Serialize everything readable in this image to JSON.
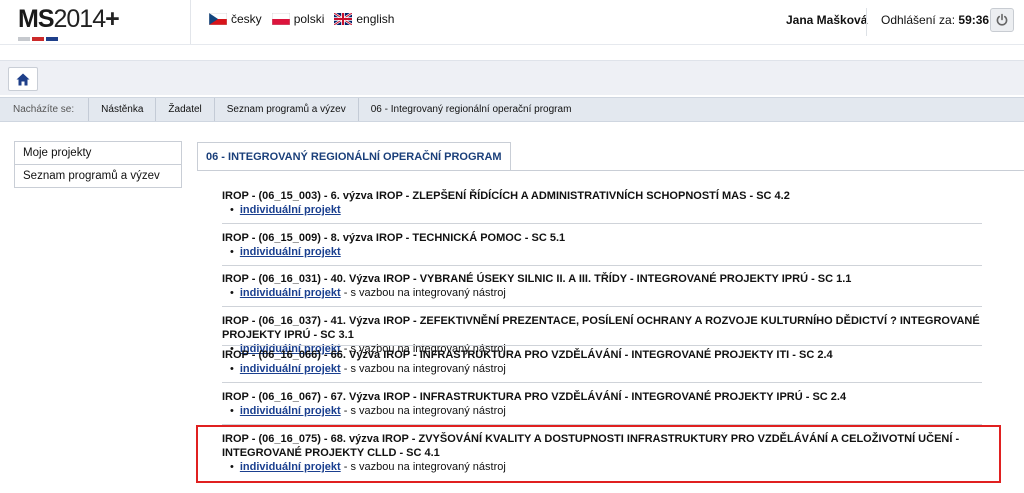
{
  "header": {
    "logo_ms": "MS",
    "logo_year": "2014",
    "logo_plus": "+",
    "languages": [
      {
        "label": "česky",
        "flag": "cz-flag-icon"
      },
      {
        "label": "polski",
        "flag": "pl-flag-icon"
      },
      {
        "label": "english",
        "flag": "uk-flag-icon"
      }
    ],
    "user_name": "Jana Mašková",
    "logout_label": "Odhlášení za:",
    "logout_timer": "59:36",
    "power_icon": "power-icon"
  },
  "toolbar": {
    "home_icon": "home-icon"
  },
  "breadcrumb": {
    "label": "Nacházíte se:",
    "items": [
      "Nástěnka",
      "Žadatel",
      "Seznam programů a výzev",
      "06 - Integrovaný regionální operační program"
    ]
  },
  "leftmenu": {
    "items": [
      "Moje projekty",
      "Seznam programů a výzev"
    ]
  },
  "tab": {
    "label": "06 - INTEGROVANÝ REGIONÁLNÍ OPERAČNÍ PROGRAM"
  },
  "calls": [
    {
      "title": "IROP - (06_15_003) - 6. výzva IROP - ZLEPŠENÍ ŘÍDÍCÍCH A ADMINISTRATIVNÍCH SCHOPNOSTÍ MAS - SC 4.2",
      "link": "individuální projekt",
      "suffix": ""
    },
    {
      "title": "IROP - (06_15_009) - 8. výzva IROP - TECHNICKÁ POMOC - SC 5.1",
      "link": "individuální projekt",
      "suffix": ""
    },
    {
      "title": "IROP - (06_16_031) - 40. Výzva IROP - VYBRANÉ ÚSEKY SILNIC II. A III. TŘÍDY - INTEGROVANÉ PROJEKTY IPRÚ - SC 1.1",
      "link": "individuální projekt",
      "suffix": " - s vazbou na integrovaný nástroj"
    },
    {
      "title": "IROP - (06_16_037) - 41. Výzva IROP - ZEFEKTIVNĚNÍ PREZENTACE, POSÍLENÍ OCHRANY A ROZVOJE KULTURNÍHO DĚDICTVÍ ? INTEGROVANÉ PROJEKTY IPRÚ - SC 3.1",
      "link": "individuální projekt",
      "suffix": " - s vazbou na integrovaný nástroj"
    },
    {
      "title": "IROP - (06_16_066) - 66. Výzva IROP - INFRASTRUKTURA PRO VZDĚLÁVÁNÍ - INTEGROVANÉ PROJEKTY ITI - SC 2.4",
      "link": "individuální projekt",
      "suffix": " - s vazbou na integrovaný nástroj"
    },
    {
      "title": "IROP - (06_16_067) - 67. Výzva IROP - INFRASTRUKTURA PRO VZDĚLÁVÁNÍ - INTEGROVANÉ PROJEKTY IPRÚ - SC 2.4",
      "link": "individuální projekt",
      "suffix": " - s vazbou na integrovaný nástroj"
    },
    {
      "title": "IROP - (06_16_075) - 68. výzva IROP - ZVYŠOVÁNÍ KVALITY A DOSTUPNOSTI INFRASTRUKTURY PRO VZDĚLÁVÁNÍ A CELOŽIVOTNÍ UČENÍ - INTEGROVANÉ PROJEKTY CLLD - SC 4.1",
      "link": "individuální projekt",
      "suffix": " - s vazbou na integrovaný nástroj"
    }
  ],
  "colors": {
    "link": "#1a3f8f",
    "highlight": "#e02020",
    "tab_text": "#1a3f7a"
  }
}
